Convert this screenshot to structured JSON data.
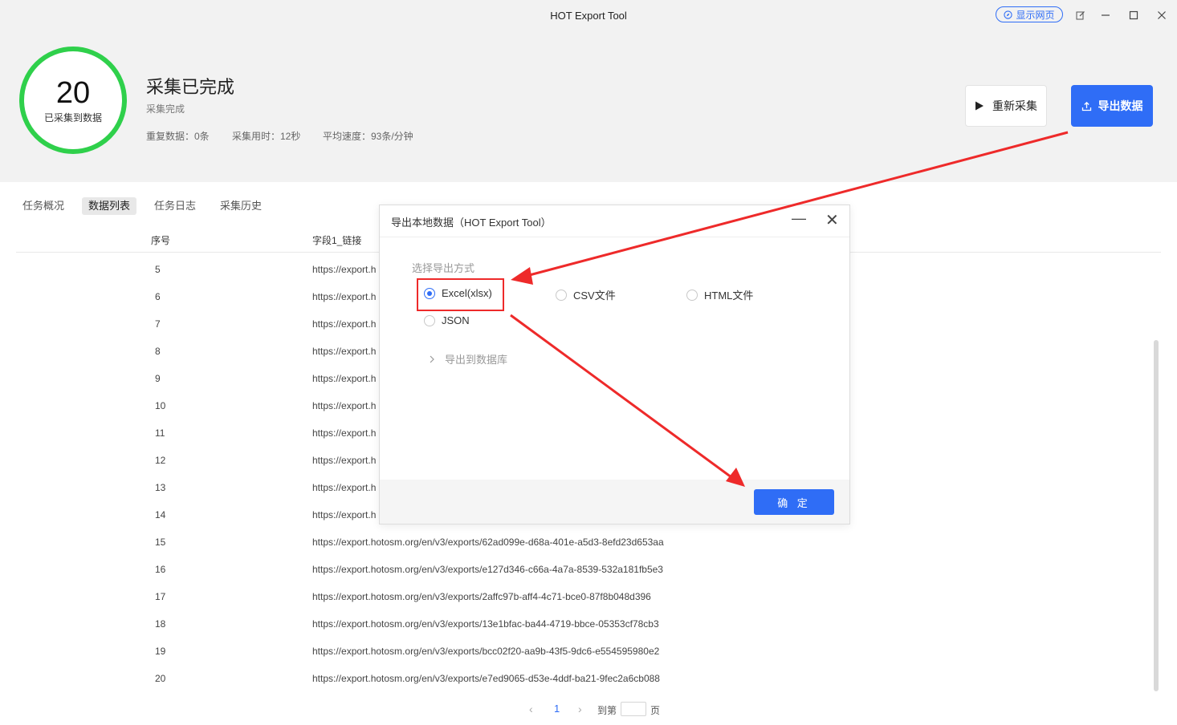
{
  "window": {
    "title": "HOT Export Tool",
    "show_web_label": "显示网页"
  },
  "header": {
    "count": "20",
    "count_label": "已采集到数据",
    "status_title": "采集已完成",
    "status_sub": "采集完成",
    "stats": {
      "duplicates": "重复数据：0条",
      "time_used": "采集用时：12秒",
      "avg_speed": "平均速度：93条/分钟"
    },
    "recollect_label": "重新采集",
    "export_label": "导出数据"
  },
  "tabs": [
    "任务概况",
    "数据列表",
    "任务日志",
    "采集历史"
  ],
  "table": {
    "columns": [
      "序号",
      "字段1_链接"
    ],
    "rows": [
      {
        "idx": "5",
        "url": "https://export.h"
      },
      {
        "idx": "6",
        "url": "https://export.h"
      },
      {
        "idx": "7",
        "url": "https://export.h"
      },
      {
        "idx": "8",
        "url": "https://export.h"
      },
      {
        "idx": "9",
        "url": "https://export.h"
      },
      {
        "idx": "10",
        "url": "https://export.h"
      },
      {
        "idx": "11",
        "url": "https://export.h"
      },
      {
        "idx": "12",
        "url": "https://export.h"
      },
      {
        "idx": "13",
        "url": "https://export.h"
      },
      {
        "idx": "14",
        "url": "https://export.h"
      },
      {
        "idx": "15",
        "url": "https://export.hotosm.org/en/v3/exports/62ad099e-d68a-401e-a5d3-8efd23d653aa"
      },
      {
        "idx": "16",
        "url": "https://export.hotosm.org/en/v3/exports/e127d346-c66a-4a7a-8539-532a181fb5e3"
      },
      {
        "idx": "17",
        "url": "https://export.hotosm.org/en/v3/exports/2affc97b-aff4-4c71-bce0-87f8b048d396"
      },
      {
        "idx": "18",
        "url": "https://export.hotosm.org/en/v3/exports/13e1bfac-ba44-4719-bbce-05353cf78cb3"
      },
      {
        "idx": "19",
        "url": "https://export.hotosm.org/en/v3/exports/bcc02f20-aa9b-43f5-9dc6-e554595980e2"
      },
      {
        "idx": "20",
        "url": "https://export.hotosm.org/en/v3/exports/e7ed9065-d53e-4ddf-ba21-9fec2a6cb088"
      }
    ]
  },
  "pager": {
    "current": "1",
    "goto_label": "到第",
    "page_label": "页"
  },
  "dialog": {
    "title": "导出本地数据（HOT Export Tool）",
    "choose_label": "选择导出方式",
    "options": [
      "Excel(xlsx)",
      "CSV文件",
      "HTML文件",
      "JSON"
    ],
    "selected": "Excel(xlsx)",
    "db_label": "导出到数据库",
    "ok_label": "确 定"
  },
  "colors": {
    "accent": "#2f6df6",
    "ring": "#2fd04b",
    "annotation": "#ee2a2a"
  }
}
